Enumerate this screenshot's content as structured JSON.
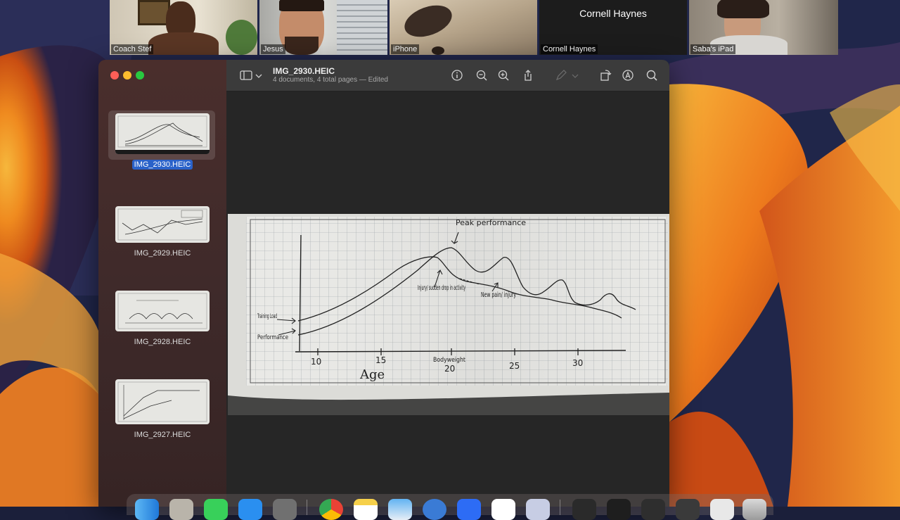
{
  "meeting": {
    "participants": [
      {
        "name": "Coach Stef"
      },
      {
        "name": "Jesus"
      },
      {
        "name": "iPhone"
      },
      {
        "name": "Cornell Haynes",
        "center_name": "Cornell Haynes"
      },
      {
        "name": "Saba's iPad"
      }
    ]
  },
  "preview": {
    "title": "IMG_2930.HEIC",
    "subtitle": "4 documents, 4 total pages — Edited",
    "toolbar_icons": [
      "sidebar-toggle-icon",
      "chevron-down-icon",
      "info-icon",
      "zoom-out-icon",
      "zoom-in-icon",
      "share-icon",
      "markup-icon",
      "chevron-down-icon",
      "rotate-icon",
      "annotate-icon",
      "search-icon"
    ],
    "thumbnails": [
      {
        "label": "IMG_2930.HEIC",
        "selected": true
      },
      {
        "label": "IMG_2929.HEIC",
        "selected": false
      },
      {
        "label": "IMG_2928.HEIC",
        "selected": false
      },
      {
        "label": "IMG_2927.HEIC",
        "selected": false
      }
    ],
    "sketch": {
      "annotations": {
        "peak": "Peak performance",
        "injury": "Injury/ sudden drop in activity",
        "new_pain": "New pain/ injury",
        "training_load": "Training Load",
        "performance": "Performance",
        "scribble": "Bodyweight"
      },
      "x_axis_label": "Age",
      "x_ticks": [
        "10",
        "15",
        "20",
        "25",
        "30"
      ]
    }
  },
  "colors": {
    "selection": "#2a62c9",
    "close": "#ff5f57",
    "minimize": "#febc2e",
    "zoom": "#28c840"
  }
}
